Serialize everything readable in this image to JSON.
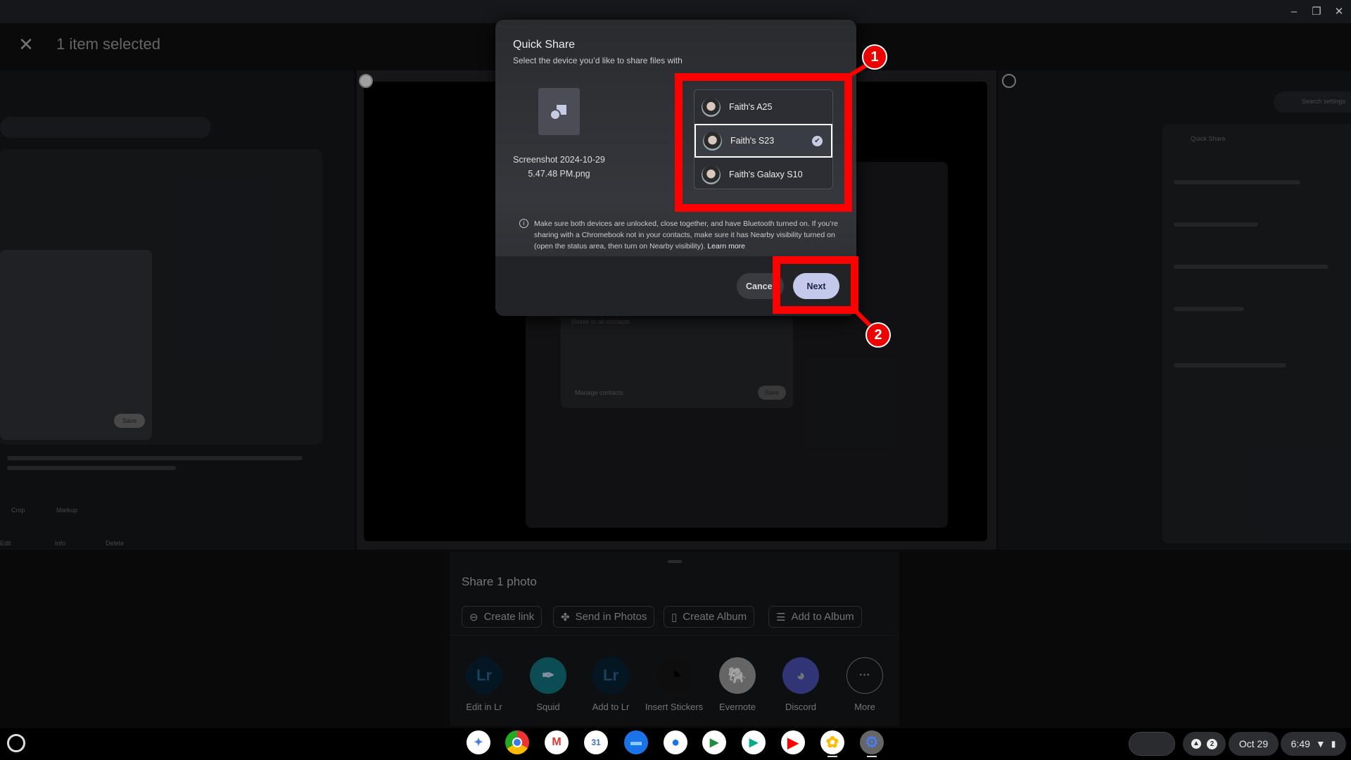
{
  "window_controls": {
    "minimize": "–",
    "restore": "❐",
    "close": "✕"
  },
  "header": {
    "close_icon": "✕",
    "selection_text": "1 item selected"
  },
  "background_thumbs": {
    "left": {
      "tools": [
        "Crop",
        "Markup"
      ],
      "actions": [
        "Edit",
        "Info",
        "Delete"
      ],
      "buttons": [
        "Save"
      ]
    },
    "middle": {
      "buttons": [
        "Manage contacts",
        "Save"
      ],
      "labels": [
        "Visible to all contacts"
      ]
    },
    "right": {
      "search_placeholder": "Search settings",
      "title": "Quick Share"
    }
  },
  "dialog": {
    "title": "Quick Share",
    "subtitle": "Select the device you’d like to share files with",
    "file_name": "Screenshot 2024-10-29 5.47.48 PM.png",
    "devices": [
      {
        "name": "Faith's A25",
        "selected": false
      },
      {
        "name": "Faith's S23",
        "selected": true
      },
      {
        "name": "Faith's Galaxy S10",
        "selected": false
      }
    ],
    "info_text": "Make sure both devices are unlocked, close together, and have Bluetooth turned on. If you’re sharing with a Chromebook not in your contacts, make sure it has Nearby visibility turned on (open the status area, then turn on Nearby visibility).",
    "learn_more": "Learn more",
    "cancel_label": "Cancel",
    "next_label": "Next"
  },
  "annotations": {
    "step1": "1",
    "step2": "2",
    "color": "#ff0000"
  },
  "share_sheet": {
    "title": "Share 1 photo",
    "actions": [
      {
        "label": "Create link",
        "icon": "link-icon"
      },
      {
        "label": "Send in Photos",
        "icon": "pinwheel-icon"
      },
      {
        "label": "Create Album",
        "icon": "album-icon"
      },
      {
        "label": "Add to Album",
        "icon": "playlist-add-icon"
      }
    ],
    "apps": [
      {
        "label": "Edit in Lr",
        "glyph": "Lr"
      },
      {
        "label": "Squid",
        "glyph": "✒"
      },
      {
        "label": "Add to Lr",
        "glyph": "Lr"
      },
      {
        "label": "Insert Stickers",
        "glyph": "◔"
      },
      {
        "label": "Evernote",
        "glyph": "🐘"
      },
      {
        "label": "Discord",
        "glyph": "◕"
      },
      {
        "label": "More",
        "glyph": "···"
      }
    ]
  },
  "taskbar": {
    "apps": [
      "Gemini",
      "Chrome",
      "Gmail",
      "Calendar",
      "Files",
      "Messages",
      "Meet",
      "Play Store",
      "YouTube",
      "Photos",
      "Settings"
    ],
    "calendar_day": "31",
    "notification_count": "2",
    "date": "Oct 29",
    "time": "6:49"
  }
}
